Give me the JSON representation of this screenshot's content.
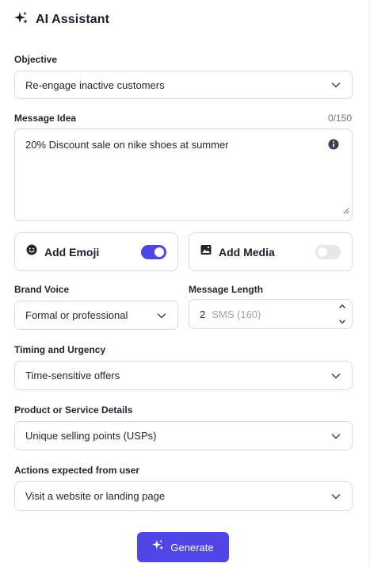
{
  "header": {
    "title": "AI Assistant",
    "icon": "sparkle-icon"
  },
  "objective": {
    "label": "Objective",
    "value": "Re-engage inactive customers"
  },
  "message_idea": {
    "label": "Message Idea",
    "counter": "0/150",
    "value": "20% Discount sale on nike shoes at summer",
    "info_icon": "info-icon"
  },
  "add_emoji": {
    "label": "Add Emoji",
    "enabled": true,
    "icon": "smiley-icon"
  },
  "add_media": {
    "label": "Add Media",
    "enabled": false,
    "icon": "image-icon"
  },
  "brand_voice": {
    "label": "Brand Voice",
    "value": "Formal or professional"
  },
  "message_length": {
    "label": "Message Length",
    "value": "2",
    "unit": "SMS (160)"
  },
  "timing": {
    "label": "Timing and Urgency",
    "value": "Time-sensitive offers"
  },
  "product": {
    "label": "Product or Service Details",
    "value": "Unique selling points (USPs)"
  },
  "actions": {
    "label": "Actions expected from user",
    "value": "Visit a website or landing page"
  },
  "generate": {
    "label": "Generate"
  },
  "colors": {
    "accent": "#4f46e5",
    "border": "#d9dce3",
    "toggle_off": "#e5e7eb"
  }
}
